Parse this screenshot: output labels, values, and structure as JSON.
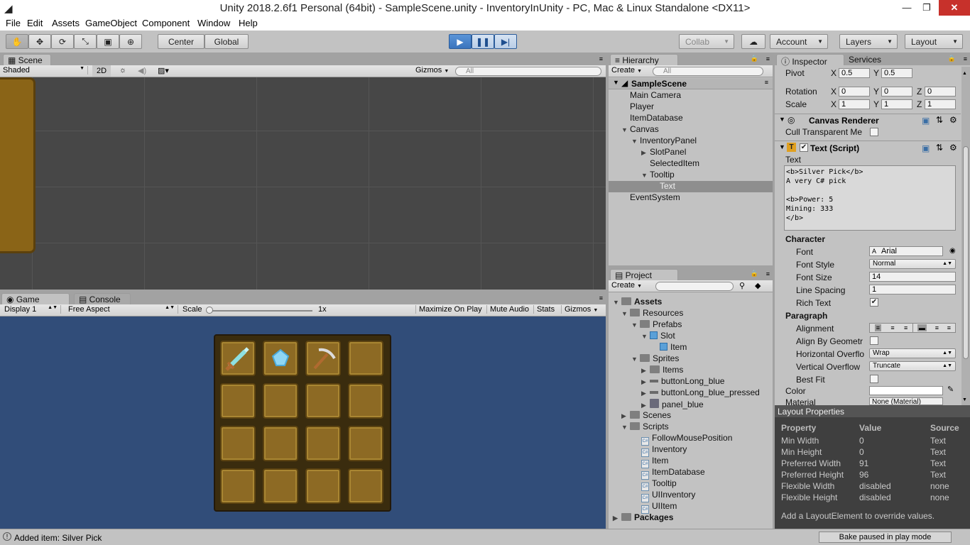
{
  "window": {
    "title": "Unity 2018.2.6f1 Personal (64bit) - SampleScene.unity - InventoryInUnity - PC, Mac & Linux Standalone <DX11>"
  },
  "menu": [
    "File",
    "Edit",
    "Assets",
    "GameObject",
    "Component",
    "Window",
    "Help"
  ],
  "toolbar": {
    "center_label": "Center",
    "global_label": "Global",
    "collab_label": "Collab",
    "account_label": "Account",
    "layers_label": "Layers",
    "layout_label": "Layout"
  },
  "scene": {
    "tab": "Scene",
    "shading": "Shaded",
    "mode2d": "2D",
    "gizmos": "Gizmos",
    "search_placeholder": "All"
  },
  "game": {
    "tab": "Game",
    "console_tab": "Console",
    "display": "Display 1",
    "aspect": "Free Aspect",
    "scale_label": "Scale",
    "scale_value": "1x",
    "maximize": "Maximize On Play",
    "mute": "Mute Audio",
    "stats": "Stats",
    "gizmos": "Gizmos",
    "inventory": {
      "rows": 4,
      "cols": 4,
      "items": [
        "sword-icon",
        "diamond-icon",
        "pickaxe-icon"
      ]
    }
  },
  "hierarchy": {
    "tab": "Hierarchy",
    "create": "Create",
    "search_placeholder": "All",
    "scene_name": "SampleScene",
    "items": [
      {
        "label": "Main Camera"
      },
      {
        "label": "Player"
      },
      {
        "label": "ItemDatabase"
      },
      {
        "label": "Canvas"
      },
      {
        "label": "InventoryPanel"
      },
      {
        "label": "SlotPanel"
      },
      {
        "label": "SelectedItem"
      },
      {
        "label": "Tooltip"
      },
      {
        "label": "Text"
      },
      {
        "label": "EventSystem"
      }
    ]
  },
  "project": {
    "tab": "Project",
    "create": "Create",
    "items": [
      {
        "label": "Assets"
      },
      {
        "label": "Resources"
      },
      {
        "label": "Prefabs"
      },
      {
        "label": "Slot"
      },
      {
        "label": "Item"
      },
      {
        "label": "Sprites"
      },
      {
        "label": "Items"
      },
      {
        "label": "buttonLong_blue"
      },
      {
        "label": "buttonLong_blue_pressed"
      },
      {
        "label": "panel_blue"
      },
      {
        "label": "Scenes"
      },
      {
        "label": "Scripts"
      },
      {
        "label": "FollowMousePosition"
      },
      {
        "label": "Inventory"
      },
      {
        "label": "Item"
      },
      {
        "label": "ItemDatabase"
      },
      {
        "label": "Tooltip"
      },
      {
        "label": "UIInventory"
      },
      {
        "label": "UIItem"
      },
      {
        "label": "Packages"
      }
    ]
  },
  "inspector": {
    "tab": "Inspector",
    "services_tab": "Services",
    "pivot": {
      "label": "Pivot",
      "x": "0.5",
      "y": "0.5"
    },
    "rotation": {
      "label": "Rotation",
      "x": "0",
      "y": "0",
      "z": "0"
    },
    "scale": {
      "label": "Scale",
      "x": "1",
      "y": "1",
      "z": "1"
    },
    "axis_x": "X",
    "axis_y": "Y",
    "axis_z": "Z",
    "canvas_renderer": "Canvas Renderer",
    "cull_label": "Cull Transparent Me",
    "text_script": "Text (Script)",
    "text_label": "Text",
    "text_value": "<b>Silver Pick</b>\nA very C# pick\n\n<b>Power: 5\nMining: 333\n</b>",
    "character": "Character",
    "font_label": "Font",
    "font_value": "Arial",
    "font_style_label": "Font Style",
    "font_style_value": "Normal",
    "font_size_label": "Font Size",
    "font_size_value": "14",
    "line_spacing_label": "Line Spacing",
    "line_spacing_value": "1",
    "rich_text_label": "Rich Text",
    "paragraph": "Paragraph",
    "alignment_label": "Alignment",
    "align_geom_label": "Align By Geometr",
    "h_overflow_label": "Horizontal Overflo",
    "h_overflow_value": "Wrap",
    "v_overflow_label": "Vertical Overflow",
    "v_overflow_value": "Truncate",
    "best_fit_label": "Best Fit",
    "color_label": "Color",
    "material_label": "Material",
    "material_value": "None (Material)"
  },
  "layout_props": {
    "title": "Layout Properties",
    "headers": [
      "Property",
      "Value",
      "Source"
    ],
    "rows": [
      [
        "Min Width",
        "0",
        "Text"
      ],
      [
        "Min Height",
        "0",
        "Text"
      ],
      [
        "Preferred Width",
        "91",
        "Text"
      ],
      [
        "Preferred Height",
        "96",
        "Text"
      ],
      [
        "Flexible Width",
        "disabled",
        "none"
      ],
      [
        "Flexible Height",
        "disabled",
        "none"
      ]
    ],
    "hint": "Add a LayoutElement to override values."
  },
  "status": {
    "message": "Added item: Silver Pick",
    "bake": "Bake paused in play mode"
  },
  "colors": {
    "play_blue": "#3a74bd",
    "game_bg": "#314d79",
    "slot": "#8d6a24"
  }
}
